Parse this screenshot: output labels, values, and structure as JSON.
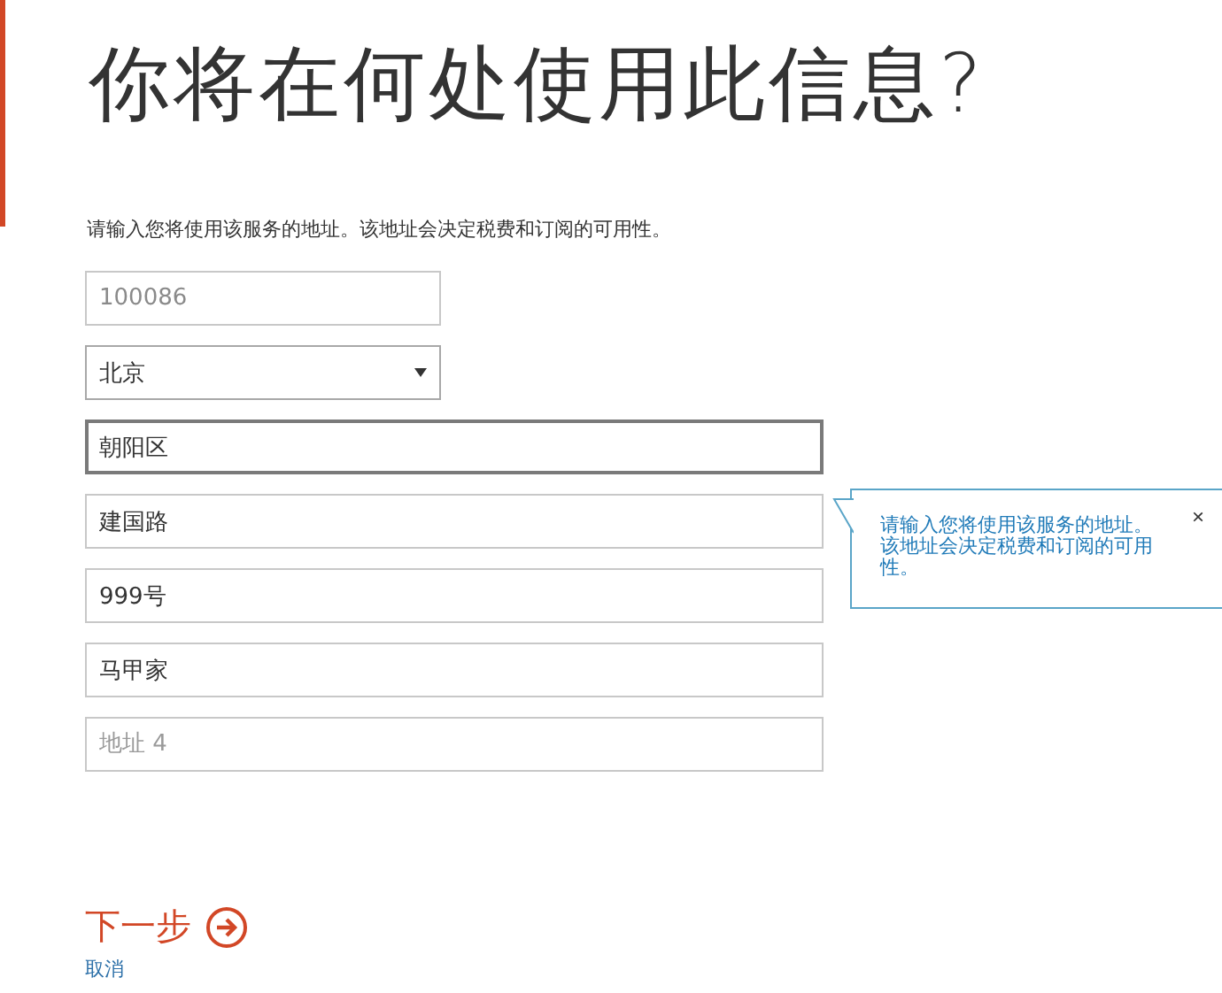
{
  "title": "你将在何处使用此信息?",
  "description": "请输入您将使用该服务的地址。该地址会决定税费和订阅的可用性。",
  "fields": [
    {
      "kind": "postal",
      "value": "100086",
      "focused": false,
      "disabled": true
    },
    {
      "kind": "select",
      "value": "北京",
      "focused": false,
      "disabled": false
    },
    {
      "kind": "text",
      "value": "朝阳区",
      "focused": true,
      "disabled": false
    },
    {
      "kind": "text",
      "value": "建国路",
      "focused": false,
      "disabled": false
    },
    {
      "kind": "text",
      "value": "999号",
      "focused": false,
      "disabled": false
    },
    {
      "kind": "text",
      "value": "马甲家",
      "focused": false,
      "disabled": false
    },
    {
      "kind": "text",
      "placeholder": "地址 4",
      "focused": false,
      "disabled": false
    }
  ],
  "tooltip": {
    "text": "请输入您将使用该服务的地址。该地址会决定税费和订阅的可用性。",
    "close": "×"
  },
  "next_button": "下一步",
  "cancel_link": "取消"
}
